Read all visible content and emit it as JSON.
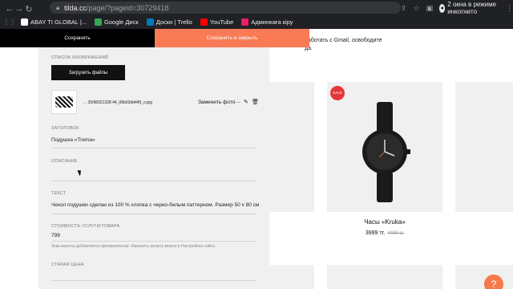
{
  "browser": {
    "url_domain": "tilda.cc",
    "url_path": "/page/?pageid=30729418",
    "incognito_label": "2 окна в режиме инкогнито",
    "bookmarks": [
      {
        "label": "ABAY TI GLOBAL |...",
        "color": "#ffffff"
      },
      {
        "label": "Google Диск",
        "color": "#34a853"
      },
      {
        "label": "Доски | Trello",
        "color": "#0079bf"
      },
      {
        "label": "YouTube",
        "color": "#ff0000"
      },
      {
        "label": "Админкаға кіру",
        "color": "#e91e63"
      }
    ]
  },
  "actions": {
    "save": "Сохранить",
    "save_close": "Сохранить и закрыть"
  },
  "panel": {
    "images_label": "СПИСОК ИЗОБРАЖЕНИЙ",
    "upload": "Загрузить файлы",
    "filename": "... 35/98321328 44_08b63dd445_o.jpg",
    "replace": "Заменить фото",
    "more": "...",
    "title_label": "ЗАГОЛОВОК",
    "title_value": "Подушка «Trema»",
    "desc_label": "ОПИСАНИЕ",
    "desc_value": "",
    "text_label": "ТЕКСТ",
    "text_value": "Чехол подушки сделан из 100 % хлопка с черно-белым паттерном. Размер 50 х 80 см",
    "price_label": "СТОИМОСТЬ УСЛУГИ/ТОВАРА",
    "price_value": "799",
    "price_hint": "Знак валюты добавляется автоматически. Изменить валюту можно в Настройках сайта.",
    "old_price_label": "СТАРАЯ ЦЕНА"
  },
  "background": {
    "intro_line1": "работать с Gmail, освободите",
    "intro_line2": "да.",
    "sale_badge": "SALE",
    "product_title": "Часы «Kruka»",
    "product_price": "3999 тг.",
    "product_old_price": "4499 тг.",
    "help_icon": "?"
  },
  "colors": {
    "accent": "#f97b56",
    "chrome": "#202124",
    "panel": "#f0f0f0"
  }
}
